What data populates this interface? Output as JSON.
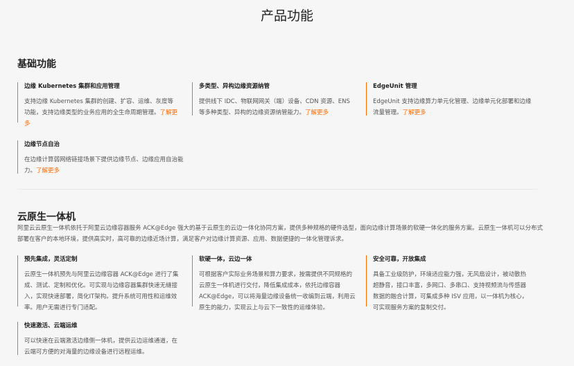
{
  "page": {
    "title": "产品功能"
  },
  "basic": {
    "title": "基础功能",
    "cards": [
      {
        "title": "边缘 Kubernetes 集群和应用管理",
        "text": "支持边缘 Kubernetes 集群的创建、扩容、运维、灰度等功能，支持边缘类型的业务应用的全生命周期管理。",
        "link": "了解更多"
      },
      {
        "title": "多类型、异构边缘资源纳管",
        "text": "提供线下 IDC、物联网网关（端）设备、CDN 资源、ENS 等多种类型、异构的边缘资源纳管能力。",
        "link": "了解更多"
      },
      {
        "title": "EdgeUnit 管理",
        "text": "EdgeUnit 支持边缘算力单元化管理、边缘单元化部署和边缘流量管理。",
        "link": "了解更多"
      },
      {
        "title": "边缘节点自治",
        "text": "在边缘计算弱网络链接场景下提供边缘节点、边缘应用自治能力。",
        "link": "了解更多"
      }
    ]
  },
  "integrated": {
    "title": "云原生一体机",
    "desc": "阿里云云原生一体机依托于阿里云边缘容器服务 ACK@Edge 强大的基于云原生的云边一体化协同方案，提供多种规格的硬件选型，面向边缘计算场景的软硬一体化的服务方案。云原生一体机可以分布式部署在客户的本地环境，提供高实时，高可靠的边缘近场计算，满足客户对边缘计算资源、应用、数据便捷的一体化管理诉求。",
    "cards": [
      {
        "title": "预先集成，灵活定制",
        "text": "云原生一体机预先与阿里云边缘容器 ACK@Edge 进行了集成、测试、定制和优化。可实现与边缘容器集群快速无缝接入，实现快速部署，简化IT架构。提升系统可用性和运维效率。用户无需进行专门适配。"
      },
      {
        "title": "软硬一体，云边一体",
        "text": "可根据客户实际业务场景和算力要求，按需提供不同规格的云原生一体机进行交付，降低集成成本，依托边缘容器 ACK@Edge，可以将海量边缘设备统一收编到云端，利用云原生的能力，实现云上与云下一致性的运维体验。"
      },
      {
        "title": "安全可靠，开放集成",
        "text": "具备工业级防护，环境适应能力强，无风扇设计，被动散热超静音，接口丰富，多网口、多串口、支持视频流与传感器数据的融合计算，可集成多种 ISV 应用，以一体机为核心，可实现服务方案的复制交付。"
      },
      {
        "title": "快速激活、云端运维",
        "text": "可以快速在云端激活边缘侧一体机，提供云边运维通道，在云端可方便的对海量的边缘设备进行远程运维。"
      }
    ]
  }
}
